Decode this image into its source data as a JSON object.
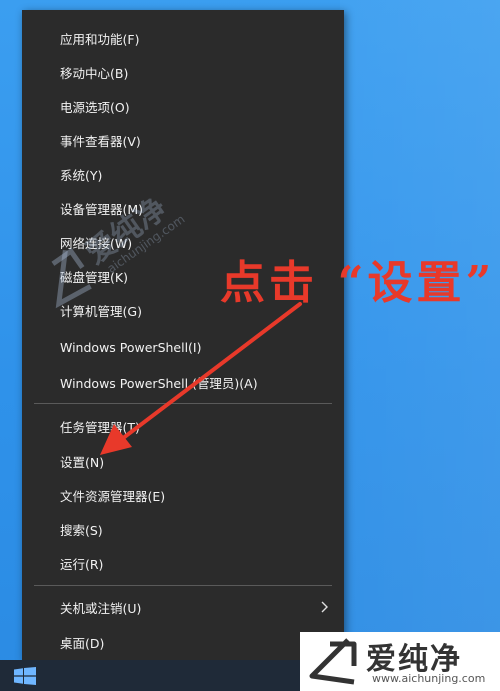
{
  "menu": {
    "group1": [
      {
        "label": "应用和功能(F)"
      },
      {
        "label": "移动中心(B)"
      },
      {
        "label": "电源选项(O)"
      },
      {
        "label": "事件查看器(V)"
      },
      {
        "label": "系统(Y)"
      },
      {
        "label": "设备管理器(M)"
      },
      {
        "label": "网络连接(W)"
      },
      {
        "label": "磁盘管理(K)"
      },
      {
        "label": "计算机管理(G)"
      },
      {
        "label": "Windows PowerShell(I)"
      },
      {
        "label": "Windows PowerShell (管理员)(A)"
      }
    ],
    "group2": [
      {
        "label": "任务管理器(T)"
      },
      {
        "label": "设置(N)"
      },
      {
        "label": "文件资源管理器(E)"
      },
      {
        "label": "搜索(S)"
      },
      {
        "label": "运行(R)"
      }
    ],
    "group3": [
      {
        "label": "关机或注销(U)"
      },
      {
        "label": "桌面(D)"
      }
    ]
  },
  "annotation": {
    "text": "点击 “设置”"
  },
  "watermark": {
    "brand": "爱纯净",
    "url": "aichunjing.com"
  },
  "logo_badge": {
    "name": "爱纯净",
    "url": "www.aichunjing.com"
  },
  "colors": {
    "menu_bg": "#2b2b2b",
    "menu_text": "#f2f2f2",
    "annotation": "#e8392a",
    "desktop": "#3b9ef0"
  },
  "icons": {
    "submenu": "chevron-right-icon",
    "start": "windows-logo-icon"
  }
}
